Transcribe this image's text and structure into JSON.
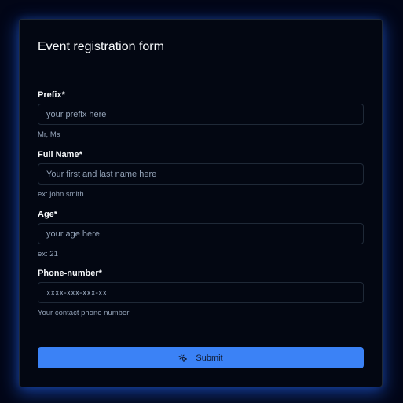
{
  "form": {
    "title": "Event registration form",
    "fields": [
      {
        "label": "Prefix*",
        "placeholder": "your prefix here",
        "hint": "Mr, Ms"
      },
      {
        "label": "Full Name*",
        "placeholder": "Your first and last name here",
        "hint": "ex: john smith"
      },
      {
        "label": "Age*",
        "placeholder": "your age here",
        "hint": "ex: 21"
      },
      {
        "label": "Phone-number*",
        "placeholder": "xxxx-xxx-xxx-xx",
        "hint": "Your contact phone number"
      }
    ],
    "submit_label": "Submit",
    "submit_icon": "mouse-pointer-click-icon"
  },
  "colors": {
    "background": "#020617",
    "card": "#030712",
    "border": "#1f2937",
    "accent": "#3b82f6",
    "glow": "#2563eb",
    "text": "#f8fafc",
    "muted": "#94a3b8"
  }
}
